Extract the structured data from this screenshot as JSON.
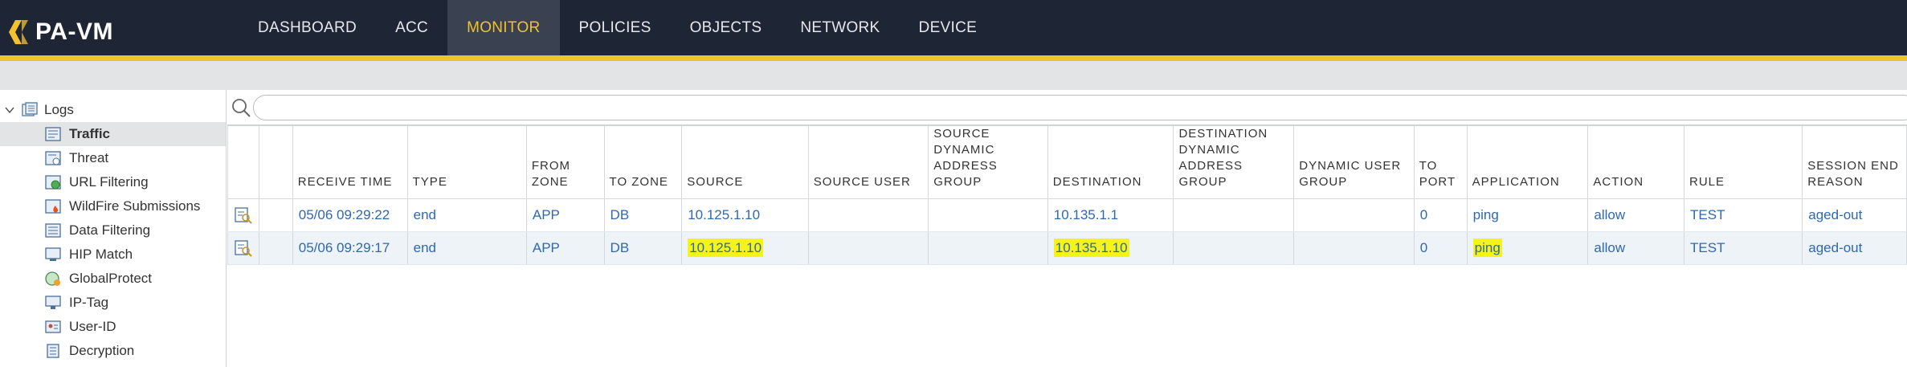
{
  "app": {
    "name": "PA-VM"
  },
  "nav": {
    "tabs": [
      {
        "label": "DASHBOARD",
        "active": false
      },
      {
        "label": "ACC",
        "active": false
      },
      {
        "label": "MONITOR",
        "active": true
      },
      {
        "label": "POLICIES",
        "active": false
      },
      {
        "label": "OBJECTS",
        "active": false
      },
      {
        "label": "NETWORK",
        "active": false
      },
      {
        "label": "DEVICE",
        "active": false
      }
    ]
  },
  "sidebar": {
    "root": "Logs",
    "items": [
      {
        "label": "Traffic",
        "icon": "traffic-log-icon",
        "selected": true
      },
      {
        "label": "Threat",
        "icon": "threat-log-icon"
      },
      {
        "label": "URL Filtering",
        "icon": "url-filtering-icon"
      },
      {
        "label": "WildFire Submissions",
        "icon": "wildfire-icon"
      },
      {
        "label": "Data Filtering",
        "icon": "data-filtering-icon"
      },
      {
        "label": "HIP Match",
        "icon": "hip-match-icon"
      },
      {
        "label": "GlobalProtect",
        "icon": "globalprotect-icon"
      },
      {
        "label": "IP-Tag",
        "icon": "ip-tag-icon"
      },
      {
        "label": "User-ID",
        "icon": "user-id-icon"
      },
      {
        "label": "Decryption",
        "icon": "decryption-icon"
      }
    ]
  },
  "filter": {
    "value": "",
    "placeholder": ""
  },
  "table": {
    "columns": [
      [
        "",
        ""
      ],
      [
        "",
        ""
      ],
      [
        "RECEIVE TIME",
        ""
      ],
      [
        "TYPE",
        ""
      ],
      [
        "FROM",
        "ZONE"
      ],
      [
        "TO ZONE",
        ""
      ],
      [
        "SOURCE",
        ""
      ],
      [
        "SOURCE USER",
        ""
      ],
      [
        "SOURCE",
        "DYNAMIC",
        "ADDRESS GROUP"
      ],
      [
        "DESTINATION",
        ""
      ],
      [
        "DESTINATION",
        "DYNAMIC",
        "ADDRESS GROUP"
      ],
      [
        "DYNAMIC USER",
        "GROUP"
      ],
      [
        "TO",
        "PORT"
      ],
      [
        "APPLICATION",
        ""
      ],
      [
        "ACTION",
        ""
      ],
      [
        "RULE",
        ""
      ],
      [
        "SESSION END",
        "REASON"
      ]
    ],
    "rows": [
      {
        "receive_time": "05/06 09:29:22",
        "type": "end",
        "from_zone": "APP",
        "to_zone": "DB",
        "source": "10.125.1.10",
        "source_user": "",
        "source_dag": "",
        "destination": "10.135.1.1",
        "destination_dag": "",
        "dynamic_user_group": "",
        "to_port": "0",
        "application": "ping",
        "action": "allow",
        "rule": "TEST",
        "session_end_reason": "aged-out",
        "highlighted": false
      },
      {
        "receive_time": "05/06 09:29:17",
        "type": "end",
        "from_zone": "APP",
        "to_zone": "DB",
        "source": "10.125.1.10",
        "source_user": "",
        "source_dag": "",
        "destination": "10.135.1.10",
        "destination_dag": "",
        "dynamic_user_group": "",
        "to_port": "0",
        "application": "ping",
        "action": "allow",
        "rule": "TEST",
        "session_end_reason": "aged-out",
        "highlighted": true
      }
    ]
  },
  "colors": {
    "topbar": "#1e2534",
    "accent": "#f2c12e",
    "link": "#2f68b1",
    "highlight": "#f4f31a"
  }
}
